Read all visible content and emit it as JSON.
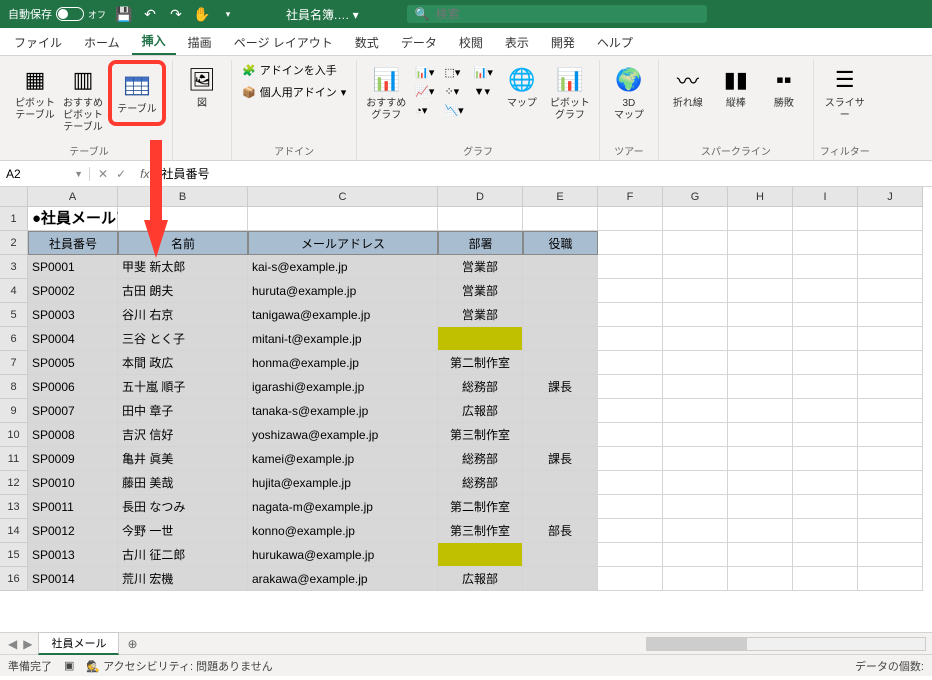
{
  "titlebar": {
    "autosave_label": "自動保存",
    "autosave_state": "オフ",
    "filename": "社員名簿.… ▾",
    "search_placeholder": "検索"
  },
  "ribbon_tabs": [
    "ファイル",
    "ホーム",
    "挿入",
    "描画",
    "ページ レイアウト",
    "数式",
    "データ",
    "校閲",
    "表示",
    "開発",
    "ヘルプ"
  ],
  "active_tab_index": 2,
  "ribbon": {
    "group_tables": {
      "label": "テーブル",
      "pivot": "ピボット\nテーブル",
      "rec_pivot": "おすすめ\nピボットテーブル",
      "table": "テーブル"
    },
    "group_illust": {
      "label": "図",
      "btn": "図"
    },
    "group_addins": {
      "label": "アドイン",
      "get": "アドインを入手",
      "my": "個人用アドイン"
    },
    "group_charts": {
      "label": "グラフ",
      "rec": "おすすめ\nグラフ",
      "maps": "マップ",
      "pivotchart": "ピボットグラフ"
    },
    "group_tours": {
      "label": "ツアー",
      "map3d": "3D\nマップ"
    },
    "group_spark": {
      "label": "スパークライン",
      "line": "折れ線",
      "column": "縦棒",
      "winloss": "勝敗"
    },
    "group_filter": {
      "label": "フィルター",
      "slicer": "スライサー"
    }
  },
  "namebox": "A2",
  "formula": "社員番号",
  "columns": [
    "A",
    "B",
    "C",
    "D",
    "E",
    "F",
    "G",
    "H",
    "I",
    "J"
  ],
  "table": {
    "title": "●社員メールアドレス一覧",
    "headers": [
      "社員番号",
      "名前",
      "メールアドレス",
      "部署",
      "役職"
    ],
    "rows": [
      {
        "id": "SP0001",
        "name": "甲斐 新太郎",
        "mail": "kai-s@example.jp",
        "dept": "営業部",
        "role": ""
      },
      {
        "id": "SP0002",
        "name": "古田 朗夫",
        "mail": "huruta@example.jp",
        "dept": "営業部",
        "role": ""
      },
      {
        "id": "SP0003",
        "name": "谷川 右京",
        "mail": "tanigawa@example.jp",
        "dept": "営業部",
        "role": ""
      },
      {
        "id": "SP0004",
        "name": "三谷 とく子",
        "mail": "mitani-t@example.jp",
        "dept": "",
        "role": "",
        "yellow_dept": true
      },
      {
        "id": "SP0005",
        "name": "本間 政広",
        "mail": "honma@example.jp",
        "dept": "第二制作室",
        "role": ""
      },
      {
        "id": "SP0006",
        "name": "五十嵐 順子",
        "mail": "igarashi@example.jp",
        "dept": "総務部",
        "role": "課長"
      },
      {
        "id": "SP0007",
        "name": "田中 章子",
        "mail": "tanaka-s@example.jp",
        "dept": "広報部",
        "role": ""
      },
      {
        "id": "SP0008",
        "name": "吉沢 信好",
        "mail": "yoshizawa@example.jp",
        "dept": "第三制作室",
        "role": ""
      },
      {
        "id": "SP0009",
        "name": "亀井 眞美",
        "mail": "kamei@example.jp",
        "dept": "総務部",
        "role": "課長"
      },
      {
        "id": "SP0010",
        "name": "藤田 美哉",
        "mail": "hujita@example.jp",
        "dept": "総務部",
        "role": ""
      },
      {
        "id": "SP0011",
        "name": "長田 なつみ",
        "mail": "nagata-m@example.jp",
        "dept": "第二制作室",
        "role": ""
      },
      {
        "id": "SP0012",
        "name": "今野 一世",
        "mail": "konno@example.jp",
        "dept": "第三制作室",
        "role": "部長"
      },
      {
        "id": "SP0013",
        "name": "古川 征二郎",
        "mail": "hurukawa@example.jp",
        "dept": "",
        "role": "",
        "yellow_dept": true
      },
      {
        "id": "SP0014",
        "name": "荒川 宏機",
        "mail": "arakawa@example.jp",
        "dept": "広報部",
        "role": ""
      }
    ]
  },
  "sheet_tab": "社員メール",
  "status": {
    "ready": "準備完了",
    "access": "アクセシビリティ: 問題ありません",
    "count": "データの個数:"
  }
}
